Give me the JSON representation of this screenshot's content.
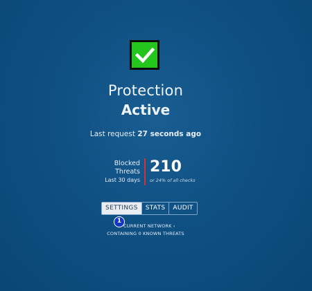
{
  "status": {
    "icon": "checkmark-icon",
    "title_prefix": "Protection",
    "title_state": "Active",
    "colors": {
      "check_background": "#24c61d",
      "accent_divider": "#d1313a",
      "badge": "#1436c5"
    }
  },
  "last_request": {
    "label": "Last request",
    "value": "27 seconds ago"
  },
  "blocked": {
    "label_line1": "Blocked",
    "label_line2": "Threats",
    "period": "Last 30 days",
    "count": "210",
    "note": "or 24% of all checks"
  },
  "tabs": [
    {
      "label": "SETTINGS",
      "active": true
    },
    {
      "label": "STATS",
      "active": false
    },
    {
      "label": "AUDIT",
      "active": false
    }
  ],
  "badge": {
    "number": "1"
  },
  "network": {
    "line1": "CURRENT NETWORK ‹",
    "line2": "CONTAINING 0 KNOWN THREATS"
  }
}
